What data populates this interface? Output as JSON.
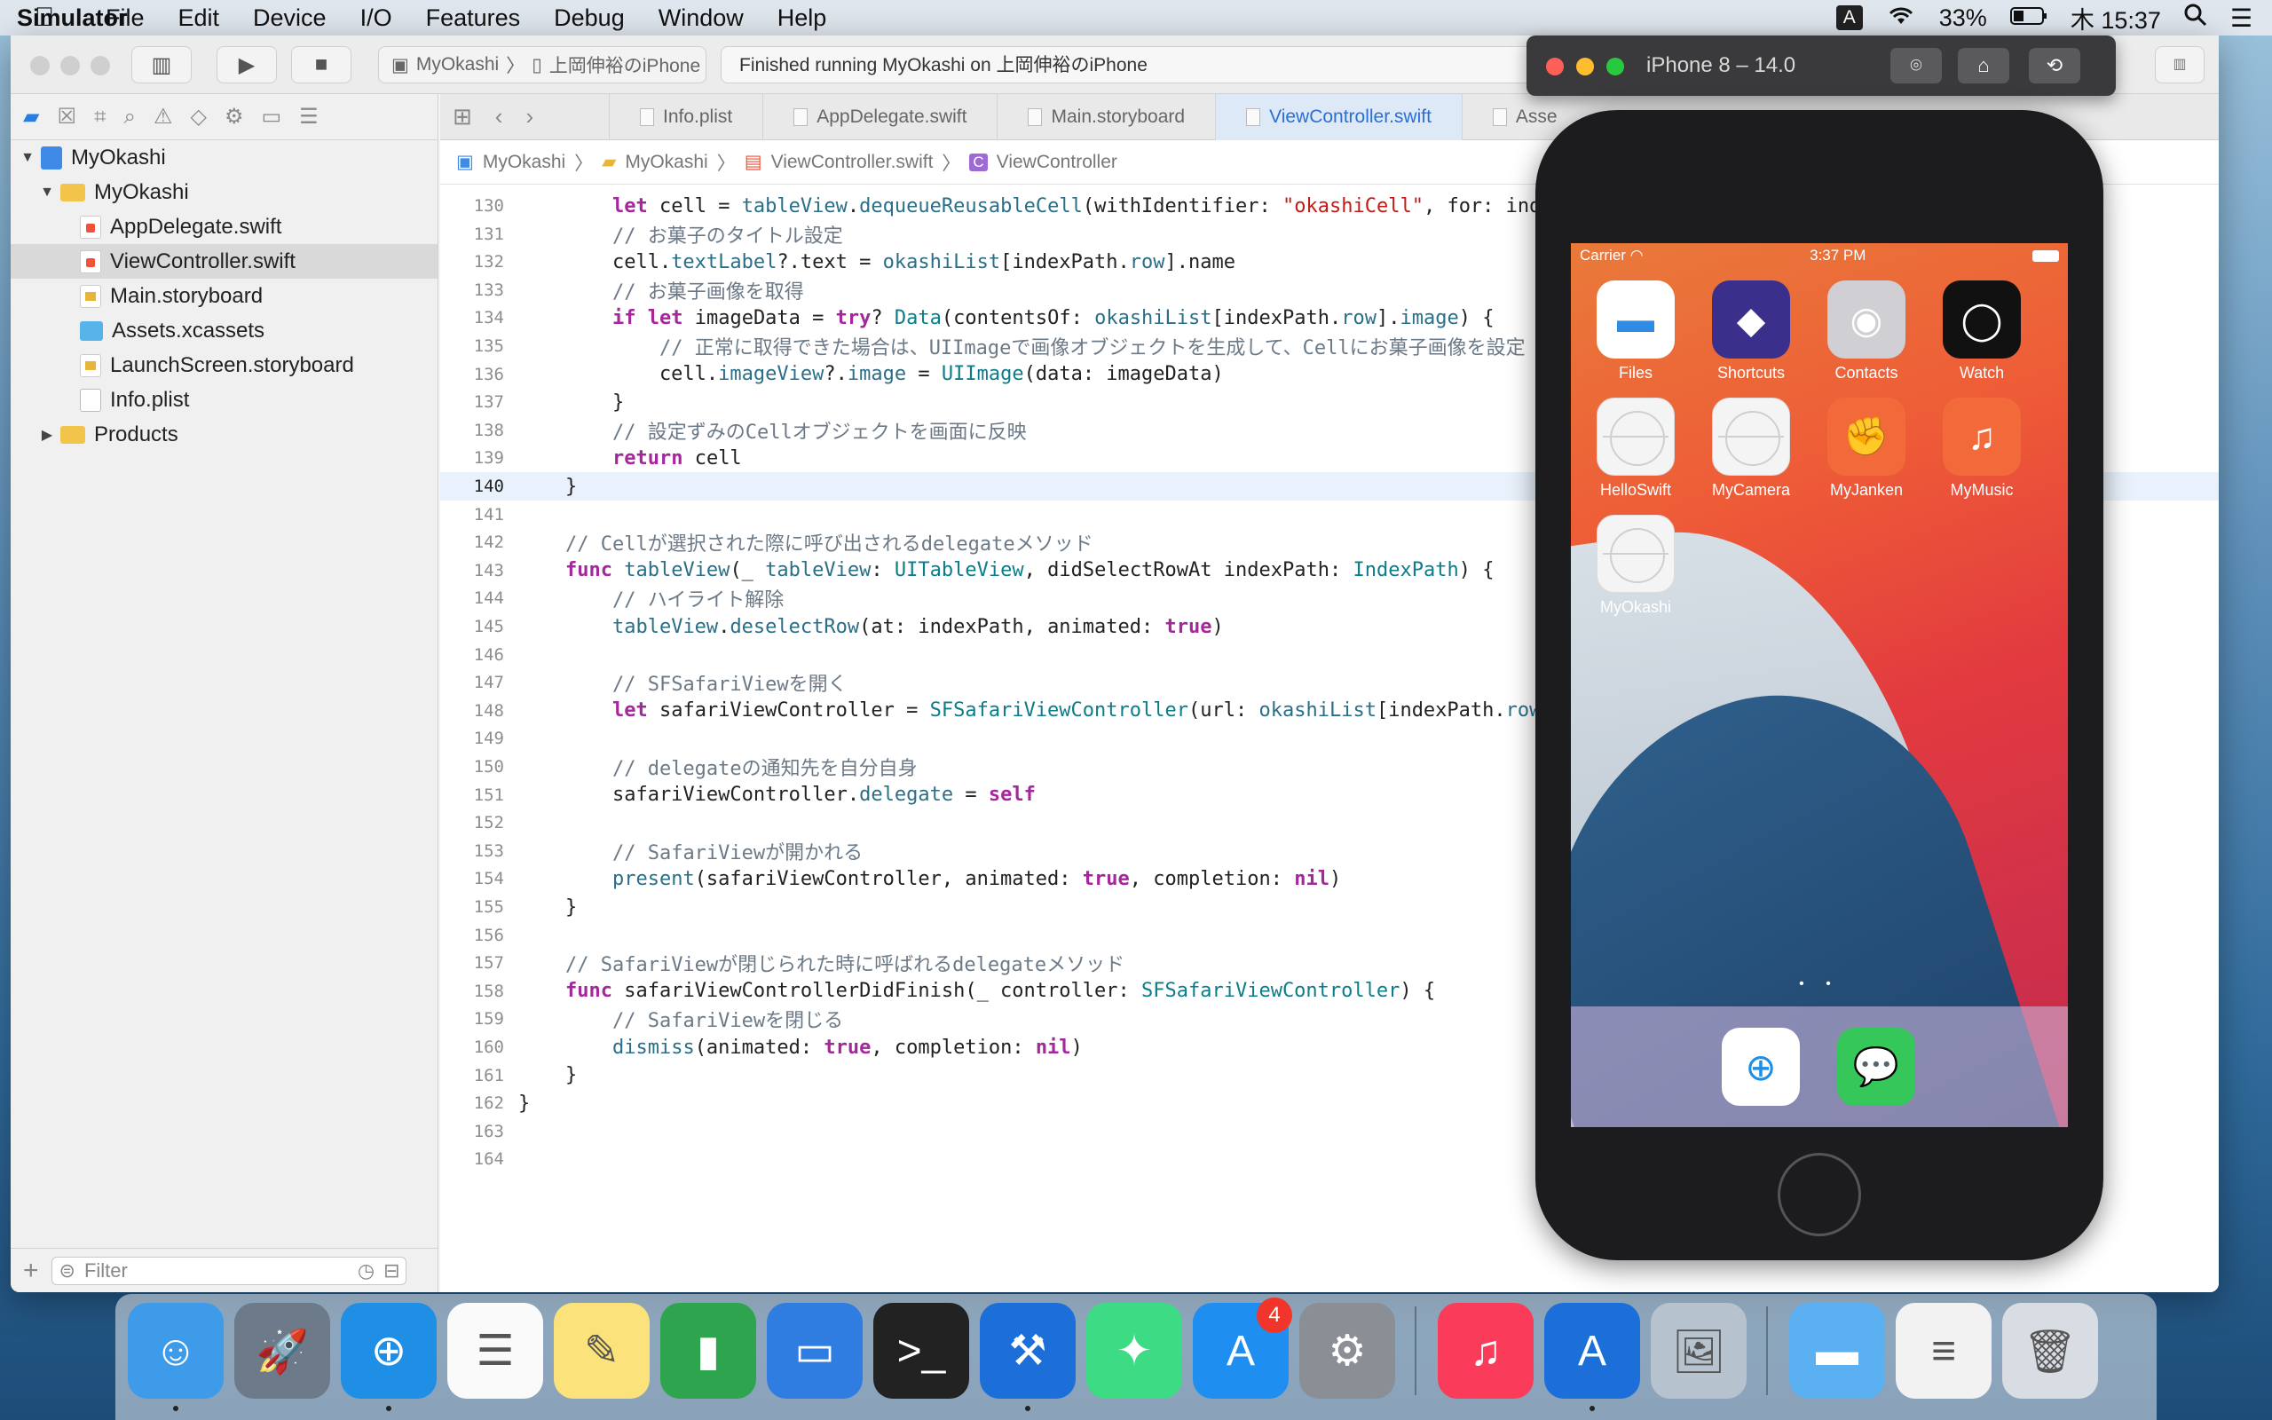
{
  "menubar": {
    "apple_icon": "apple-icon",
    "app_name": "Simulator",
    "items": [
      "File",
      "Edit",
      "Device",
      "I/O",
      "Features",
      "Debug",
      "Window",
      "Help"
    ],
    "input_indicator": "A",
    "battery": "33%",
    "clock": "木 15:37"
  },
  "xcode": {
    "scheme_project": "MyOkashi",
    "scheme_device": "上岡伸裕のiPhone",
    "status": "Finished running MyOkashi on 上岡伸裕のiPhone",
    "navigator": {
      "rows": [
        {
          "label": "MyOkashi",
          "type": "proj"
        },
        {
          "label": "MyOkashi",
          "type": "folder"
        },
        {
          "label": "AppDelegate.swift",
          "type": "swift"
        },
        {
          "label": "ViewController.swift",
          "type": "swift"
        },
        {
          "label": "Main.storyboard",
          "type": "sb"
        },
        {
          "label": "Assets.xcassets",
          "type": "assets"
        },
        {
          "label": "LaunchScreen.storyboard",
          "type": "sb"
        },
        {
          "label": "Info.plist",
          "type": "plist"
        },
        {
          "label": "Products",
          "type": "folder"
        }
      ],
      "filter_placeholder": "Filter"
    },
    "tabs": [
      "Info.plist",
      "AppDelegate.swift",
      "Main.storyboard",
      "ViewController.swift",
      "Asse"
    ],
    "active_tab": "ViewController.swift",
    "jumpbar": [
      "MyOkashi",
      "MyOkashi",
      "ViewController.swift",
      "ViewController"
    ],
    "code": {
      "current_line": 140,
      "lines": [
        {
          "n": 130,
          "text": "        let cell = tableView.dequeueReusableCell(withIdentifier: \"okashiCell\", for: ind"
        },
        {
          "n": 131,
          "text": "        // お菓子のタイトル設定"
        },
        {
          "n": 132,
          "text": "        cell.textLabel?.text = okashiList[indexPath.row].name"
        },
        {
          "n": 133,
          "text": "        // お菓子画像を取得"
        },
        {
          "n": 134,
          "text": "        if let imageData = try? Data(contentsOf: okashiList[indexPath.row].image) {"
        },
        {
          "n": 135,
          "text": "            // 正常に取得できた場合は、UIImageで画像オブジェクトを生成して、Cellにお菓子画像を設定"
        },
        {
          "n": 136,
          "text": "            cell.imageView?.image = UIImage(data: imageData)"
        },
        {
          "n": 137,
          "text": "        }"
        },
        {
          "n": 138,
          "text": "        // 設定ずみのCellオブジェクトを画面に反映"
        },
        {
          "n": 139,
          "text": "        return cell"
        },
        {
          "n": 140,
          "text": "    }"
        },
        {
          "n": 141,
          "text": ""
        },
        {
          "n": 142,
          "text": "    // Cellが選択された際に呼び出されるdelegateメソッド"
        },
        {
          "n": 143,
          "text": "    func tableView(_ tableView: UITableView, didSelectRowAt indexPath: IndexPath) {"
        },
        {
          "n": 144,
          "text": "        // ハイライト解除"
        },
        {
          "n": 145,
          "text": "        tableView.deselectRow(at: indexPath, animated: true)"
        },
        {
          "n": 146,
          "text": ""
        },
        {
          "n": 147,
          "text": "        // SFSafariViewを開く"
        },
        {
          "n": 148,
          "text": "        let safariViewController = SFSafariViewController(url: okashiList[indexPath.row"
        },
        {
          "n": 149,
          "text": ""
        },
        {
          "n": 150,
          "text": "        // delegateの通知先を自分自身"
        },
        {
          "n": 151,
          "text": "        safariViewController.delegate = self"
        },
        {
          "n": 152,
          "text": ""
        },
        {
          "n": 153,
          "text": "        // SafariViewが開かれる"
        },
        {
          "n": 154,
          "text": "        present(safariViewController, animated: true, completion: nil)"
        },
        {
          "n": 155,
          "text": "    }"
        },
        {
          "n": 156,
          "text": ""
        },
        {
          "n": 157,
          "text": "    // SafariViewが閉じられた時に呼ばれるdelegateメソッド"
        },
        {
          "n": 158,
          "text": "    func safariViewControllerDidFinish(_ controller: SFSafariViewController) {"
        },
        {
          "n": 159,
          "text": "        // SafariViewを閉じる"
        },
        {
          "n": 160,
          "text": "        dismiss(animated: true, completion: nil)"
        },
        {
          "n": 161,
          "text": "    }"
        },
        {
          "n": 162,
          "text": "}"
        },
        {
          "n": 163,
          "text": ""
        },
        {
          "n": 164,
          "text": ""
        }
      ]
    }
  },
  "simulator": {
    "title": "iPhone 8 – 14.0",
    "carrier": "Carrier",
    "time": "3:37 PM",
    "apps": [
      {
        "label": "Files",
        "icon": "files-icon",
        "color": "#2e8be6",
        "glyph": "▬"
      },
      {
        "label": "Shortcuts",
        "icon": "shortcuts-icon",
        "color": "#3b2f8c",
        "glyph": "◆"
      },
      {
        "label": "Contacts",
        "icon": "contacts-icon",
        "color": "#cfcfd4",
        "glyph": "◉"
      },
      {
        "label": "Watch",
        "icon": "watch-icon",
        "color": "#111111",
        "glyph": "◯"
      },
      {
        "label": "HelloSwift",
        "icon": "blank-app-icon",
        "color": "#f4f4f4",
        "glyph": ""
      },
      {
        "label": "MyCamera",
        "icon": "blank-app-icon",
        "color": "#f4f4f4",
        "glyph": ""
      },
      {
        "label": "MyJanken",
        "icon": "janken-icon",
        "color": "#f26a3a",
        "glyph": "✊"
      },
      {
        "label": "MyMusic",
        "icon": "music-note-icon",
        "color": "#f26a3a",
        "glyph": "♫"
      },
      {
        "label": "MyOkashi",
        "icon": "blank-app-icon",
        "color": "#f4f4f4",
        "glyph": ""
      }
    ],
    "page_dots": "• •",
    "dock_apps": [
      {
        "icon": "safari-icon",
        "color": "#ffffff",
        "glyph": "⊕"
      },
      {
        "icon": "messages-icon",
        "color": "#35c759",
        "glyph": "💬"
      }
    ]
  },
  "dock": {
    "apps": [
      {
        "name": "finder-icon",
        "color": "#3e9bea",
        "glyph": "☺",
        "running": true
      },
      {
        "name": "launchpad-icon",
        "color": "#6c7a8a",
        "glyph": "🚀",
        "running": false
      },
      {
        "name": "safari-icon",
        "color": "#1f8fe6",
        "glyph": "⊕",
        "running": true
      },
      {
        "name": "reminders-icon",
        "color": "#fafafa",
        "glyph": "☰",
        "running": false
      },
      {
        "name": "notes-icon",
        "color": "#fbe27a",
        "glyph": "✎",
        "running": false
      },
      {
        "name": "numbers-icon",
        "color": "#2ea44f",
        "glyph": "▮",
        "running": false
      },
      {
        "name": "keynote-icon",
        "color": "#2f7de1",
        "glyph": "▭",
        "running": false
      },
      {
        "name": "terminal-icon",
        "color": "#222222",
        "glyph": ">_",
        "running": false
      },
      {
        "name": "xcode-icon",
        "color": "#1c6fd9",
        "glyph": "⚒",
        "running": true
      },
      {
        "name": "android-studio-icon",
        "color": "#3ddc84",
        "glyph": "✦",
        "running": false
      },
      {
        "name": "app-store-icon",
        "color": "#1e8ff0",
        "glyph": "A",
        "running": false,
        "badge": "4"
      },
      {
        "name": "system-preferences-icon",
        "color": "#8a8f96",
        "glyph": "⚙",
        "running": false
      },
      {
        "name": "music-icon",
        "color": "#fa3c5a",
        "glyph": "♫",
        "running": false
      },
      {
        "name": "simulator-icon",
        "color": "#1c6fd9",
        "glyph": "A",
        "running": true
      },
      {
        "name": "preview-icon",
        "color": "#b7c2cf",
        "glyph": "🖼",
        "running": false
      },
      {
        "name": "folder-icon",
        "color": "#5ab0f0",
        "glyph": "▬",
        "running": false
      },
      {
        "name": "document-icon",
        "color": "#f2f2f2",
        "glyph": "≡",
        "running": false
      },
      {
        "name": "trash-icon",
        "color": "#d8dde3",
        "glyph": "🗑",
        "running": false
      }
    ]
  }
}
